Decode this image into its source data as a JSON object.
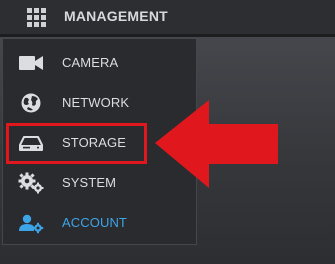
{
  "header": {
    "title": "MANAGEMENT",
    "menu_icon": "grid-icon"
  },
  "menu": {
    "items": [
      {
        "label": "CAMERA",
        "icon": "camera-icon",
        "selected": false
      },
      {
        "label": "NETWORK",
        "icon": "network-globe-icon",
        "selected": false
      },
      {
        "label": "STORAGE",
        "icon": "storage-drive-icon",
        "selected": false,
        "highlighted": true
      },
      {
        "label": "SYSTEM",
        "icon": "gears-icon",
        "selected": false
      },
      {
        "label": "ACCOUNT",
        "icon": "user-gear-icon",
        "selected": true
      }
    ]
  },
  "annotation": {
    "highlight_color": "#e0181d",
    "arrow_color": "#e0181d",
    "points_to": "STORAGE"
  },
  "colors": {
    "accent": "#3ea4e8",
    "text": "#dcdde0",
    "menu_bg": "#2a2b2e",
    "topbar_bg": "#2d2e31"
  }
}
